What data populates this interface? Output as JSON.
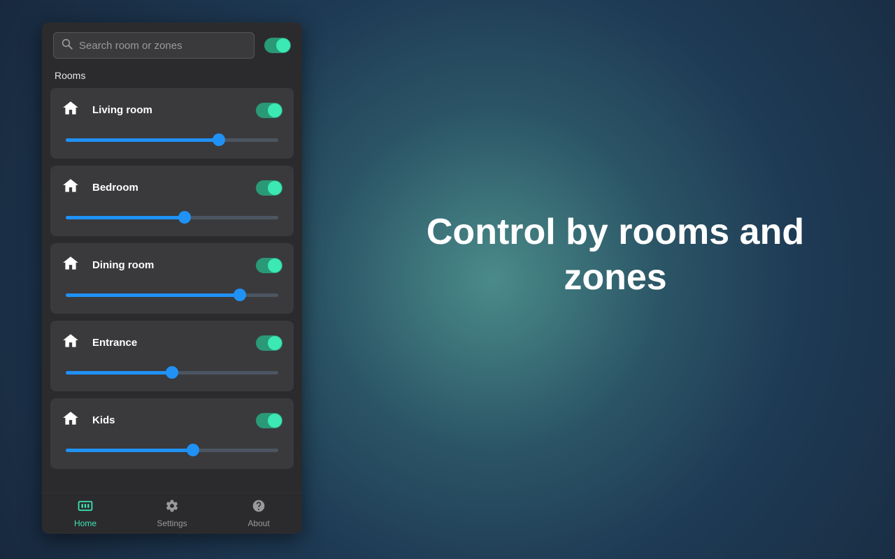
{
  "search": {
    "placeholder": "Search room or zones"
  },
  "master_toggle": true,
  "section_label": "Rooms",
  "rooms": [
    {
      "name": "Living room",
      "on": true,
      "level": 72
    },
    {
      "name": "Bedroom",
      "on": true,
      "level": 56
    },
    {
      "name": "Dining room",
      "on": true,
      "level": 82
    },
    {
      "name": "Entrance",
      "on": true,
      "level": 50
    },
    {
      "name": "Kids",
      "on": true,
      "level": 60
    }
  ],
  "nav": {
    "items": [
      {
        "id": "home",
        "label": "Home",
        "active": true
      },
      {
        "id": "settings",
        "label": "Settings",
        "active": false
      },
      {
        "id": "about",
        "label": "About",
        "active": false
      }
    ]
  },
  "hero": {
    "text": "Control by rooms and zones"
  },
  "colors": {
    "accent": "#3ce8b3",
    "slider": "#2091f5"
  }
}
